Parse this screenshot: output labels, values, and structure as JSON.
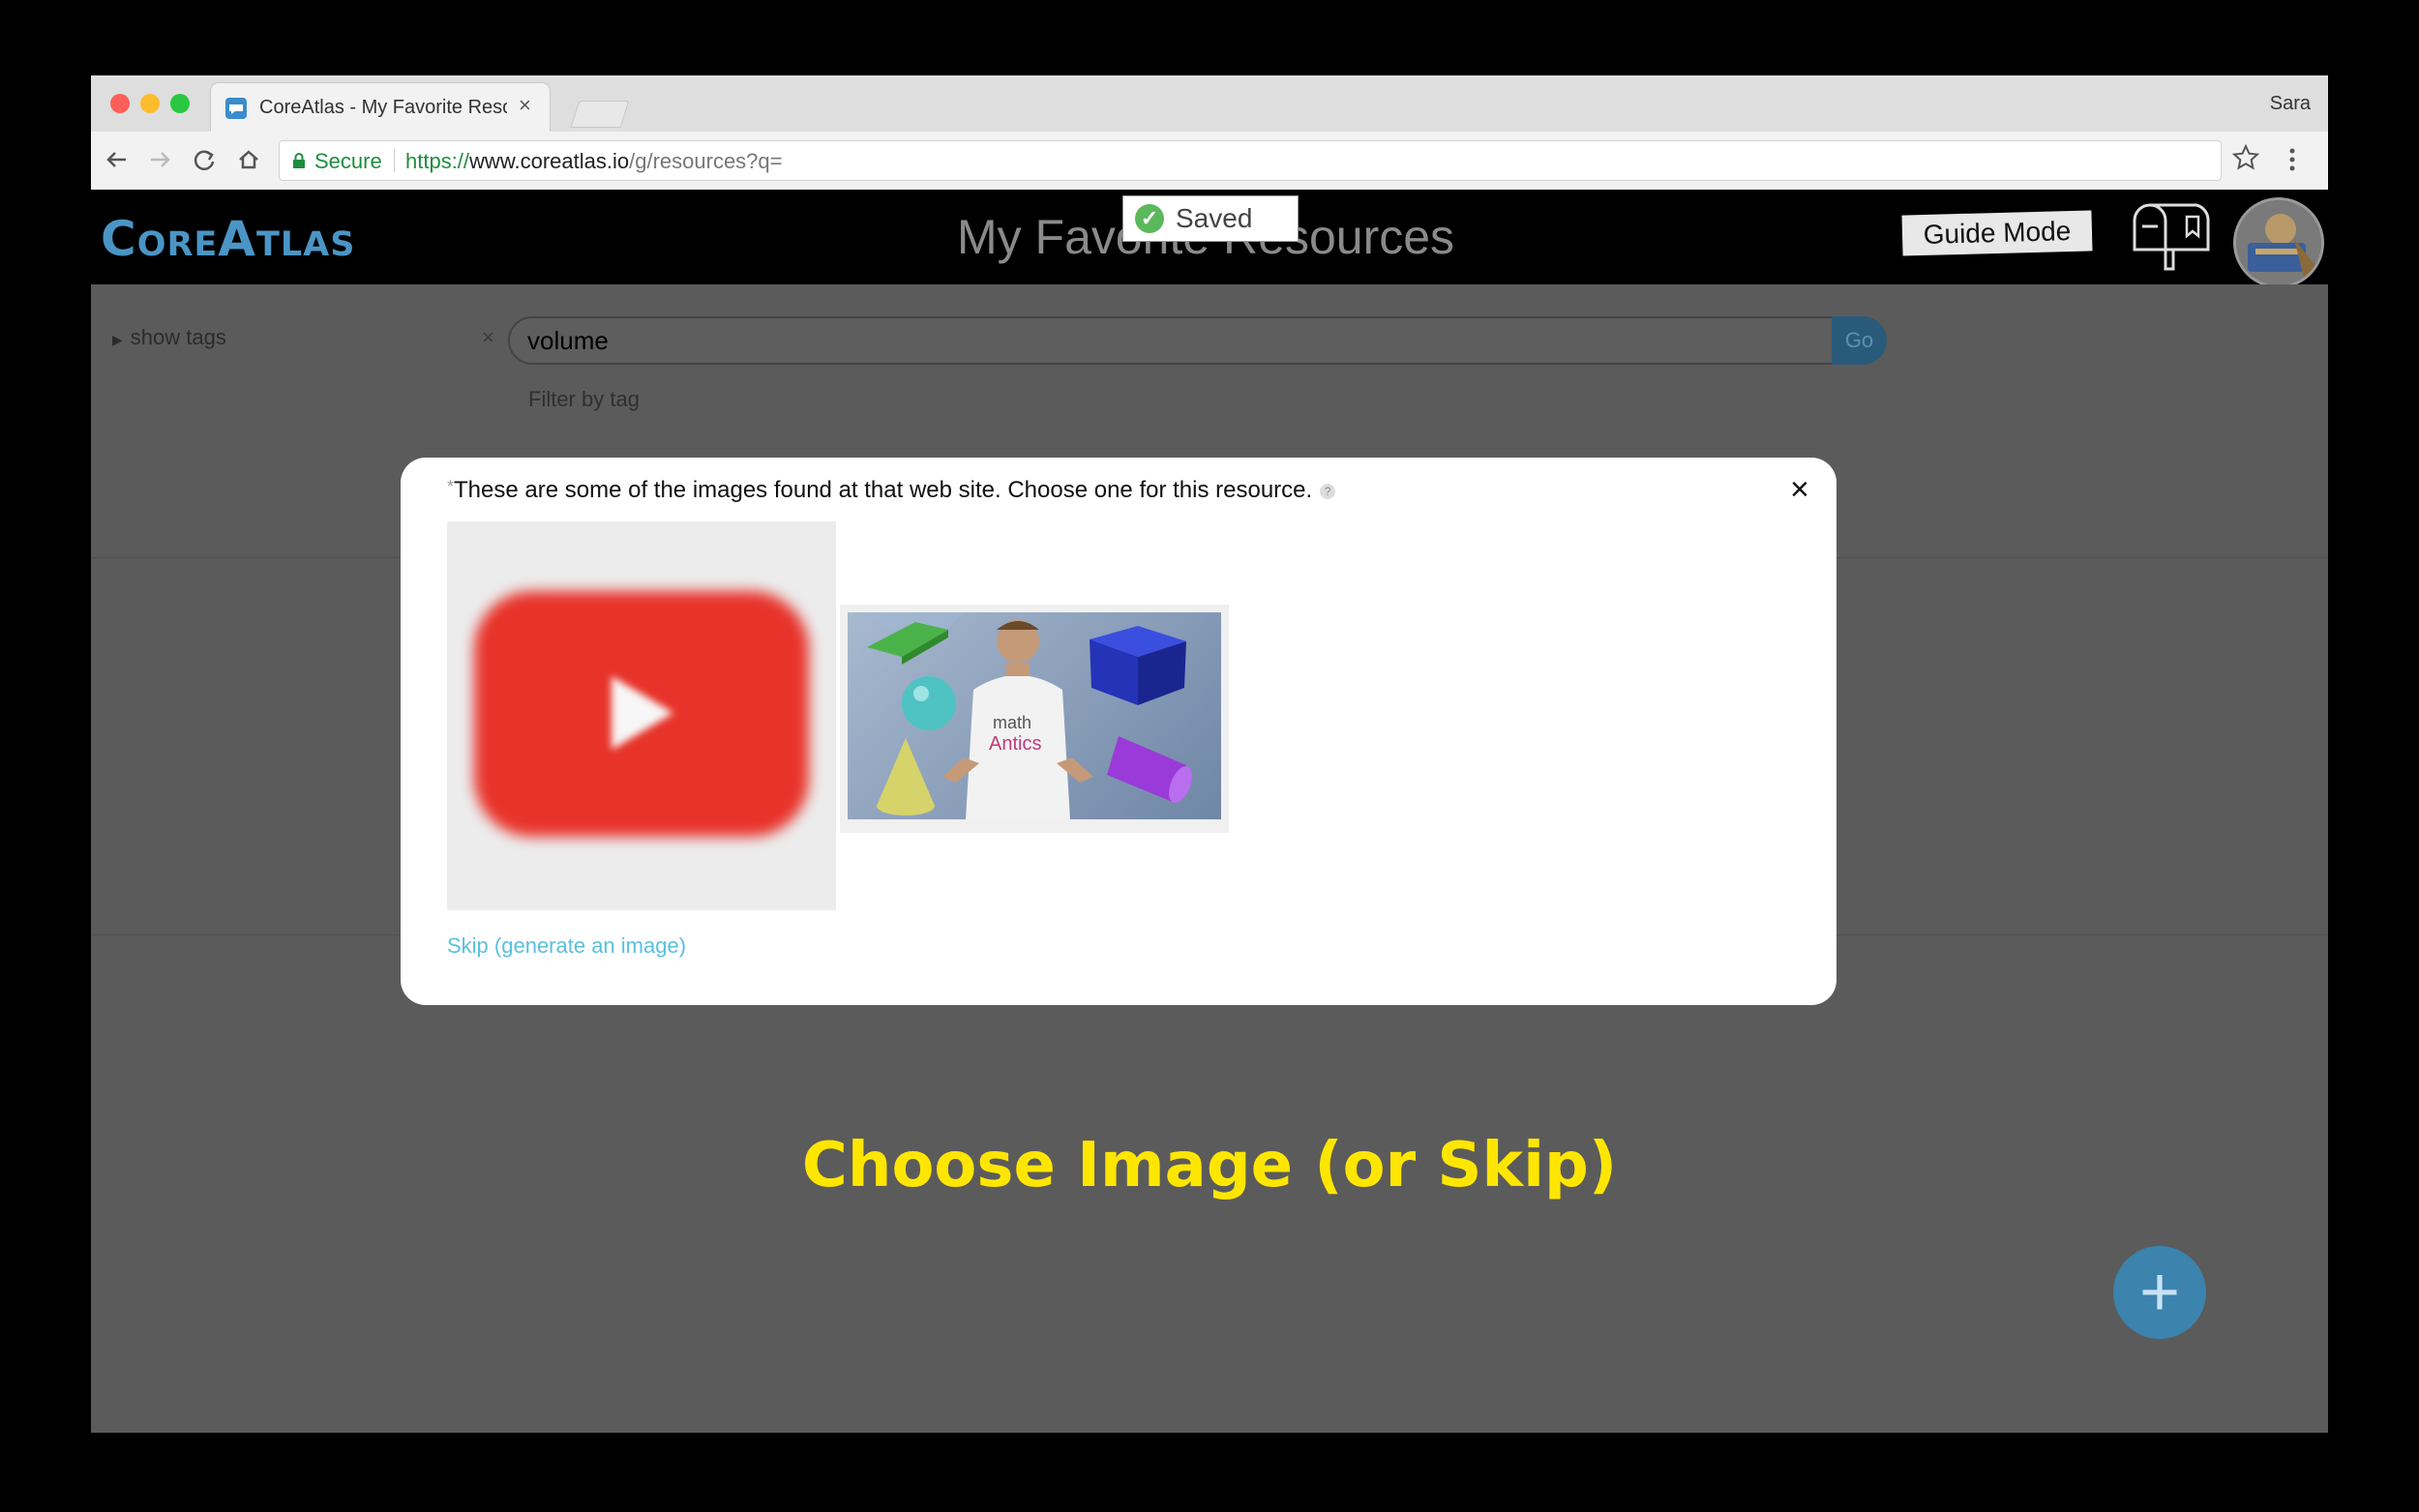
{
  "browser": {
    "tab_title": "CoreAtlas - My Favorite Resour",
    "tab_close": "×",
    "profile_name": "Sara",
    "secure_label": "Secure",
    "url_scheme": "https://",
    "url_host": "www.coreatlas.io",
    "url_path": "/g/resources?q="
  },
  "header": {
    "logo": "CoreAtlas",
    "title": "My Favorite Resources",
    "saved_label": "Saved",
    "saved_icon": "check-circle-icon",
    "guide_mode_label": "Guide Mode"
  },
  "toolbar": {
    "show_tags_label": "show tags",
    "search_clear": "×",
    "search_value": "volume",
    "go_label": "Go",
    "filter_label": "Filter by tag"
  },
  "modal": {
    "asterisk": "*",
    "prompt": "These are some of the images found at that web site. Choose one for this resource.",
    "help": "?",
    "close_label": "×",
    "skip_label": "Skip (generate an image)",
    "thumb_text": "math Antics"
  },
  "caption": "Choose Image (or Skip)",
  "fab_label": "+",
  "colors": {
    "accent_blue": "#3c83ad",
    "logo_blue": "#4a95c5",
    "caption_yellow": "#ffe600",
    "youtube_red": "#e8332a",
    "secure_green": "#1e8e3e",
    "link_blue": "#5bc0de"
  }
}
